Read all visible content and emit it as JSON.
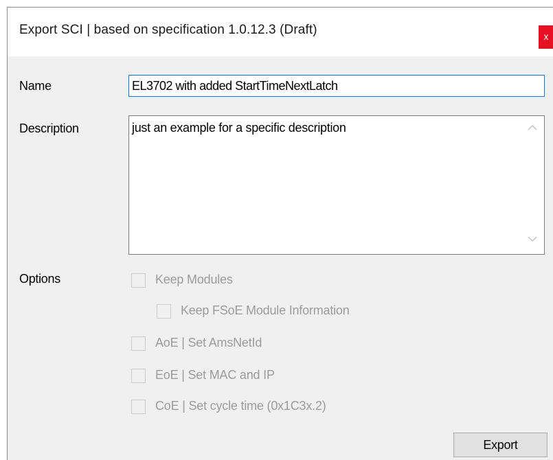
{
  "dialog": {
    "title": "Export SCI | based on specification 1.0.12.3 (Draft)",
    "close_glyph": "x"
  },
  "form": {
    "name_label": "Name",
    "name_value": "EL3702 with added StartTimeNextLatch",
    "description_label": "Description",
    "description_value": "just an example for a specific description",
    "scroll_up_glyph": "^",
    "scroll_down_glyph": "v",
    "options_label": "Options",
    "options": [
      {
        "label": "Keep Modules",
        "checked": false,
        "enabled": false
      },
      {
        "label": "Keep FSoE Module Information",
        "checked": false,
        "enabled": false
      },
      {
        "label": "AoE | Set AmsNetId",
        "checked": false,
        "enabled": false
      },
      {
        "label": "EoE | Set MAC and IP",
        "checked": false,
        "enabled": false
      },
      {
        "label": "CoE | Set cycle time (0x1C3x.2)",
        "checked": false,
        "enabled": false
      }
    ]
  },
  "actions": {
    "export_label": "Export"
  }
}
